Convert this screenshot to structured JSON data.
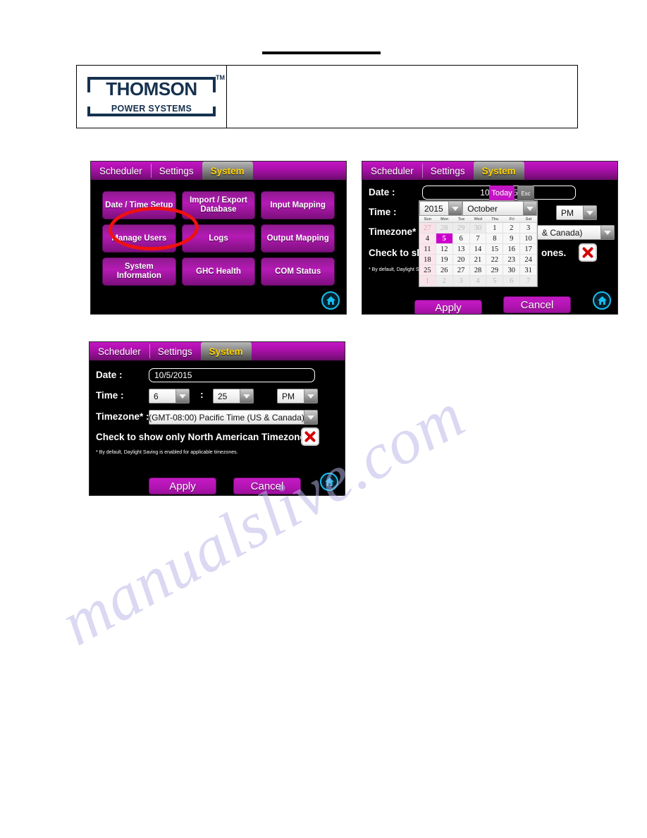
{
  "header": {
    "logo_word": "THOMSON",
    "logo_sub": "POWER SYSTEMS",
    "logo_tm": "TM"
  },
  "watermark": {
    "text": "manualslive.com"
  },
  "tabs": {
    "scheduler": "Scheduler",
    "settings": "Settings",
    "system": "System"
  },
  "panel1": {
    "menu": [
      "Date / Time Setup",
      "Import / Export Database",
      "Input Mapping",
      "Manage Users",
      "Logs",
      "Output Mapping",
      "System Information",
      "GHC Health",
      "COM Status"
    ],
    "home_icon": "home-icon",
    "annotation": "red-ellipse-highlight"
  },
  "form": {
    "date_label": "Date :",
    "date_value": "10/5/2015",
    "time_label": "Time :",
    "hour": "6",
    "minute": "25",
    "meridiem": "PM",
    "time_separator": ":",
    "timezone_label": "Timezone* :",
    "timezone_value": "(GMT-08:00) Pacific Time (US & Canada)",
    "timezone_value_clipped": "& Canada)",
    "checkbox_text": "Check to show only North American Timezones.",
    "checkbox_text_clipped_left": "Check to show",
    "checkbox_text_clipped_right": "ones.",
    "checkbox_state_icon": "red-x-icon",
    "footnote": "* By default, Daylight Saving is enabled for applicable timezones.",
    "footnote_clipped": "* By default, Daylight Savi",
    "apply_label": "Apply",
    "cancel_label": "Cancel",
    "cancel_label_clipped": "cel"
  },
  "calendar": {
    "today_label": "Today",
    "esc_label": "Esc",
    "year": "2015",
    "month": "October",
    "weekdays": [
      "Sun",
      "Mon",
      "Tue",
      "Wed",
      "Thu",
      "Fri",
      "Sat"
    ],
    "selected_day": 5,
    "weeks": [
      [
        {
          "d": "27",
          "out": true
        },
        {
          "d": "28",
          "out": true
        },
        {
          "d": "29",
          "out": true
        },
        {
          "d": "30",
          "out": true
        },
        {
          "d": "1"
        },
        {
          "d": "2"
        },
        {
          "d": "3"
        }
      ],
      [
        {
          "d": "4"
        },
        {
          "d": "5",
          "sel": true
        },
        {
          "d": "6"
        },
        {
          "d": "7"
        },
        {
          "d": "8"
        },
        {
          "d": "9"
        },
        {
          "d": "10"
        }
      ],
      [
        {
          "d": "11"
        },
        {
          "d": "12"
        },
        {
          "d": "13"
        },
        {
          "d": "14"
        },
        {
          "d": "15"
        },
        {
          "d": "16"
        },
        {
          "d": "17"
        }
      ],
      [
        {
          "d": "18"
        },
        {
          "d": "19"
        },
        {
          "d": "20"
        },
        {
          "d": "21"
        },
        {
          "d": "22"
        },
        {
          "d": "23"
        },
        {
          "d": "24"
        }
      ],
      [
        {
          "d": "25"
        },
        {
          "d": "26"
        },
        {
          "d": "27"
        },
        {
          "d": "28"
        },
        {
          "d": "29"
        },
        {
          "d": "30"
        },
        {
          "d": "31"
        }
      ],
      [
        {
          "d": "1",
          "out": true
        },
        {
          "d": "2",
          "out": true
        },
        {
          "d": "3",
          "out": true
        },
        {
          "d": "4",
          "out": true
        },
        {
          "d": "5",
          "out": true
        },
        {
          "d": "6",
          "out": true
        },
        {
          "d": "7",
          "out": true
        }
      ]
    ]
  },
  "colors": {
    "magenta": "#c413c4",
    "purple_dark": "#6d0c6d",
    "active_tab_text": "#ffd400",
    "home_cyan": "#17c0f0",
    "annotation_red": "#ee1111",
    "logo_navy": "#16314f"
  }
}
